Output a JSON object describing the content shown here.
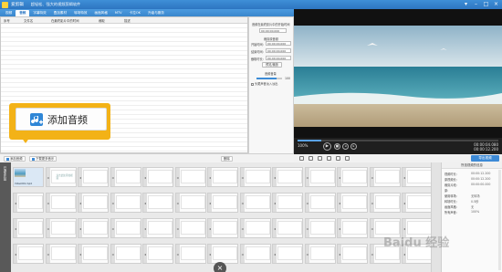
{
  "window": {
    "title": "爱剪辑",
    "subtitle": "超轻松、强大的视频剪辑软件"
  },
  "menu": {
    "tabs": [
      {
        "label": "视频",
        "active": false
      },
      {
        "label": "音频",
        "active": true
      },
      {
        "label": "字幕特效",
        "active": false
      },
      {
        "label": "叠加素材",
        "active": false
      },
      {
        "label": "转场特效",
        "active": false
      },
      {
        "label": "画面风格",
        "active": false
      },
      {
        "label": "MTV",
        "active": false
      },
      {
        "label": "卡拉OK",
        "active": false
      },
      {
        "label": "升级与服务",
        "active": false
      }
    ]
  },
  "list": {
    "columns": [
      "序号",
      "文件名",
      "在最终影片中的时间",
      "裁取",
      "描述"
    ]
  },
  "settings": {
    "title": "音频在最终影片中的开始时间",
    "start_value": "00:00:00.000",
    "section_clip": "裁剪原音频",
    "start_label": "开始时间:",
    "start_time": "00:00:00.000",
    "end_label": "结束时间:",
    "end_time": "00:00:00.000",
    "duration_label": "截取时长:",
    "duration_value": "00:00:00.000",
    "preview_button": "预览/播放",
    "section_volume": "音频音量",
    "volume_value": "100",
    "fade_label": "头尾声音淡入淡出",
    "confirm_button": "确认修改"
  },
  "callout": {
    "label": "添加音频"
  },
  "toolbar": {
    "add_audio": "添加音频",
    "download_music": "下载更多音乐",
    "delete": "删除"
  },
  "player": {
    "current_time": "00:00:04.080",
    "total_time": "00:00:12.200",
    "speed_label": "100%",
    "progress": 0.12
  },
  "timeline_bar": {
    "export_button": "导出视频"
  },
  "timeline": {
    "left_labels": [
      "已添加片段",
      "双击此处添加视频"
    ],
    "clip_name": "Video001.mp4",
    "clip_time": "12.20",
    "empty_hint": "双击此处添加视频"
  },
  "info": {
    "title": "所选视频的信息",
    "rows": [
      {
        "label": "视频时长:",
        "value": "00:00:12.200"
      },
      {
        "label": "原视频长:",
        "value": "00:00:12.200"
      },
      {
        "label": "裁剪片段:",
        "value": "00:00:00.000"
      },
      {
        "label": "原:",
        "value": ""
      },
      {
        "label": "使用转场:",
        "value": "无转场"
      },
      {
        "label": "转场时长:",
        "value": "0.5秒"
      },
      {
        "label": "画面风格:",
        "value": "无"
      },
      {
        "label": "所有声音:",
        "value": "100%"
      }
    ]
  },
  "watermark": "Baidu 经验",
  "colors": {
    "brand_blue": "#2d75c1",
    "highlight_orange": "#f3b217",
    "export_blue": "#3d8ad6"
  }
}
